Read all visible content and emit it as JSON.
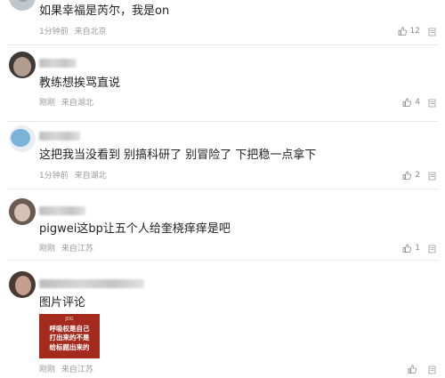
{
  "comments": [
    {
      "text": "如果幸福是芮尔，我是on",
      "time": "1分钟前",
      "location": "来自北京",
      "likes": "12",
      "avatar_colors": [
        "#c0c6cc",
        "#9aa2a9"
      ]
    },
    {
      "text": "教练想挨骂直说",
      "time": "刚刚",
      "location": "来自湖北",
      "likes": "4",
      "avatar_colors": [
        "#3d3936",
        "#b29c8d"
      ]
    },
    {
      "text": "这把我当没看到 别搞科研了 别冒险了 下把稳一点拿下",
      "time": "1分钟前",
      "location": "来自湖北",
      "likes": "2",
      "avatar_colors": [
        "#7ab3d9",
        "#e9eef4"
      ]
    },
    {
      "text": "pigwei这bp让五个人给奎桡痒痒是吧",
      "time": "刚刚",
      "location": "来自江苏",
      "likes": "1",
      "avatar_colors": [
        "#6b5a52",
        "#d7c3b6"
      ]
    },
    {
      "text": "图片评论",
      "time": "刚刚",
      "location": "来自江苏",
      "likes": "",
      "avatar_colors": [
        "#4a3a34",
        "#c49e8e"
      ],
      "image": {
        "brand": "JDG",
        "lines": [
          "呼吸权是自己",
          "打出来的不是",
          "给标题出来的"
        ],
        "background": "#a52a1e"
      }
    }
  ]
}
